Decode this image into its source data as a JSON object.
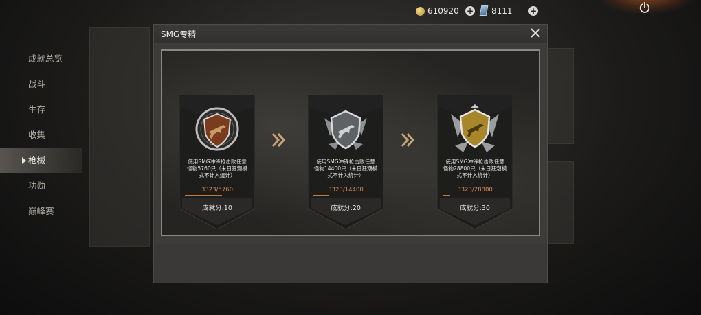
{
  "currency": {
    "coins": "610920",
    "cards": "8111",
    "add_label": "+"
  },
  "sidebar": {
    "items": [
      {
        "label": "成就总览",
        "active": false
      },
      {
        "label": "战斗",
        "active": false
      },
      {
        "label": "生存",
        "active": false
      },
      {
        "label": "收集",
        "active": false
      },
      {
        "label": "枪械",
        "active": true
      },
      {
        "label": "功勋",
        "active": false
      },
      {
        "label": "巅峰赛",
        "active": false
      }
    ]
  },
  "modal": {
    "title": "SMG专精",
    "badges": [
      {
        "tier": "bronze",
        "desc_line1": "使用SMG冲锋枪击败任意",
        "desc_line2": "怪物5760只（末日狂潮模",
        "desc_line3": "式不计入统计）",
        "progress_text": "3323/5760",
        "progress_fraction": 0.577,
        "score_text": "成就分:10"
      },
      {
        "tier": "silver",
        "desc_line1": "使用SMG冲锋枪击败任意",
        "desc_line2": "怪物14400只（末日狂潮模",
        "desc_line3": "式不计入统计）",
        "progress_text": "3323/14400",
        "progress_fraction": 0.231,
        "score_text": "成就分:20"
      },
      {
        "tier": "gold",
        "desc_line1": "使用SMG冲锋枪击败任意",
        "desc_line2": "怪物28800只（末日狂潮模",
        "desc_line3": "式不计入统计）",
        "progress_text": "3323/28800",
        "progress_fraction": 0.115,
        "score_text": "成就分:30"
      }
    ]
  },
  "colors": {
    "bronze": "#8a4a22",
    "silver": "#8c8f91",
    "gold": "#a8862c",
    "accent": "#c97a3a"
  },
  "icons": [
    "coin-icon",
    "plus-icon",
    "card-icon",
    "power-icon",
    "close-icon",
    "chevron-right-icon",
    "smg-emblem-icon"
  ]
}
